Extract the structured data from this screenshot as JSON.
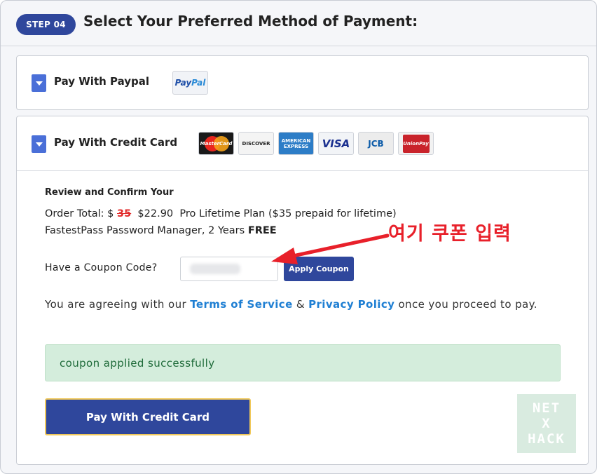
{
  "header": {
    "step_badge": "STEP 04",
    "title": "Select Your Preferred Method of Payment:"
  },
  "paypal_panel": {
    "label": "Pay With Paypal",
    "logo_text_a": "Pay",
    "logo_text_b": "Pal"
  },
  "card_panel": {
    "label": "Pay With Credit Card",
    "card_logos": {
      "mastercard": "MasterCard",
      "discover": "DISCOVER",
      "amex_1": "AMERICAN",
      "amex_2": "EXPRESS",
      "visa": "VISA",
      "jcb": "JCB",
      "unionpay": "UnionPay"
    },
    "review_title": "Review and Confirm Your",
    "order_total_label": "Order Total: $",
    "original_price": "35",
    "new_price": "$22.90",
    "plan_text": "Pro Lifetime Plan ($35 prepaid for lifetime)",
    "bundle_text": "FastestPass Password Manager, 2 Years",
    "bundle_free": "FREE",
    "coupon_label": "Have a Coupon Code?",
    "coupon_value": "",
    "apply_label": "Apply Coupon",
    "terms_prefix": "You are agreeing with our",
    "terms_link": "Terms of Service",
    "terms_amp": "&",
    "privacy_link": "Privacy Policy",
    "terms_suffix": "once you proceed to pay.",
    "success_message": "coupon applied successfully",
    "pay_button": "Pay With Credit Card"
  },
  "annotation": {
    "text": "여기 쿠폰 입력",
    "color": "#e8202a"
  },
  "watermark": {
    "line1": "NET",
    "line2": "X",
    "line3": "HACK"
  },
  "colors": {
    "primary": "#2f479c",
    "toggle": "#4a6fd8",
    "link": "#1f7fd3",
    "success_bg": "#d4eddc",
    "success_text": "#1f6b3a",
    "strike": "#e12b2b"
  }
}
